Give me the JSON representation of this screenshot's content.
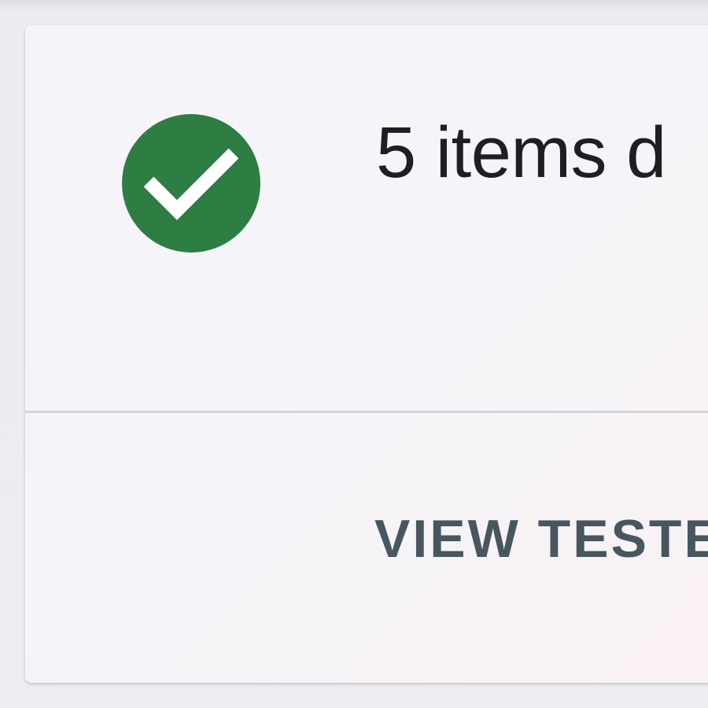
{
  "dialog": {
    "status_icon": "check-circle-icon",
    "status_color": "#2e7d43",
    "title": "5 items d",
    "action_label": "VIEW TESTE"
  }
}
